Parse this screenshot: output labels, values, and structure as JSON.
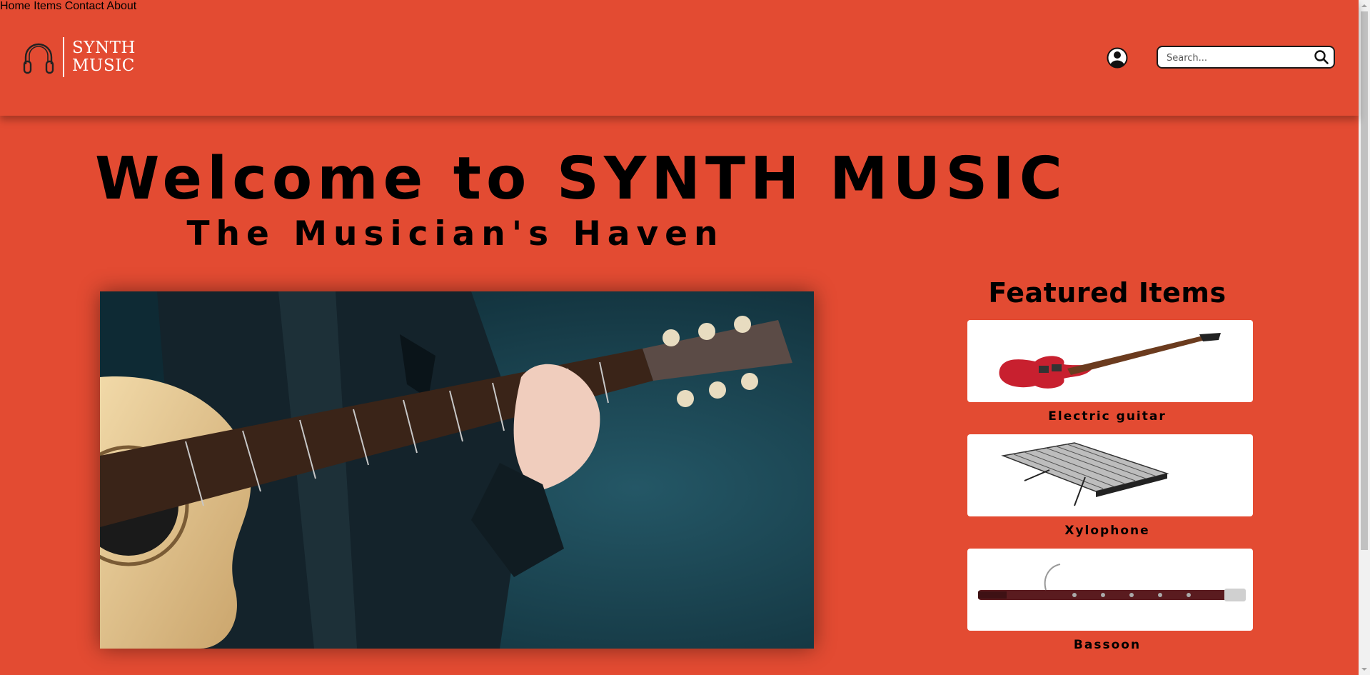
{
  "brand": {
    "line1": "SYNTH",
    "line2": "MUSIC"
  },
  "nav": [
    {
      "label": "Home"
    },
    {
      "label": "Items"
    },
    {
      "label": "Contact"
    },
    {
      "label": "About"
    }
  ],
  "search": {
    "placeholder": "Search..."
  },
  "hero": {
    "title": "Welcome to SYNTH MUSIC",
    "subtitle": "The Musician's Haven"
  },
  "featured": {
    "title": "Featured Items",
    "items": [
      {
        "label": "Electric guitar"
      },
      {
        "label": "Xylophone"
      },
      {
        "label": "Bassoon"
      }
    ]
  },
  "colors": {
    "background": "#e34b32",
    "text": "#000000",
    "header_text": "#ffffff"
  }
}
